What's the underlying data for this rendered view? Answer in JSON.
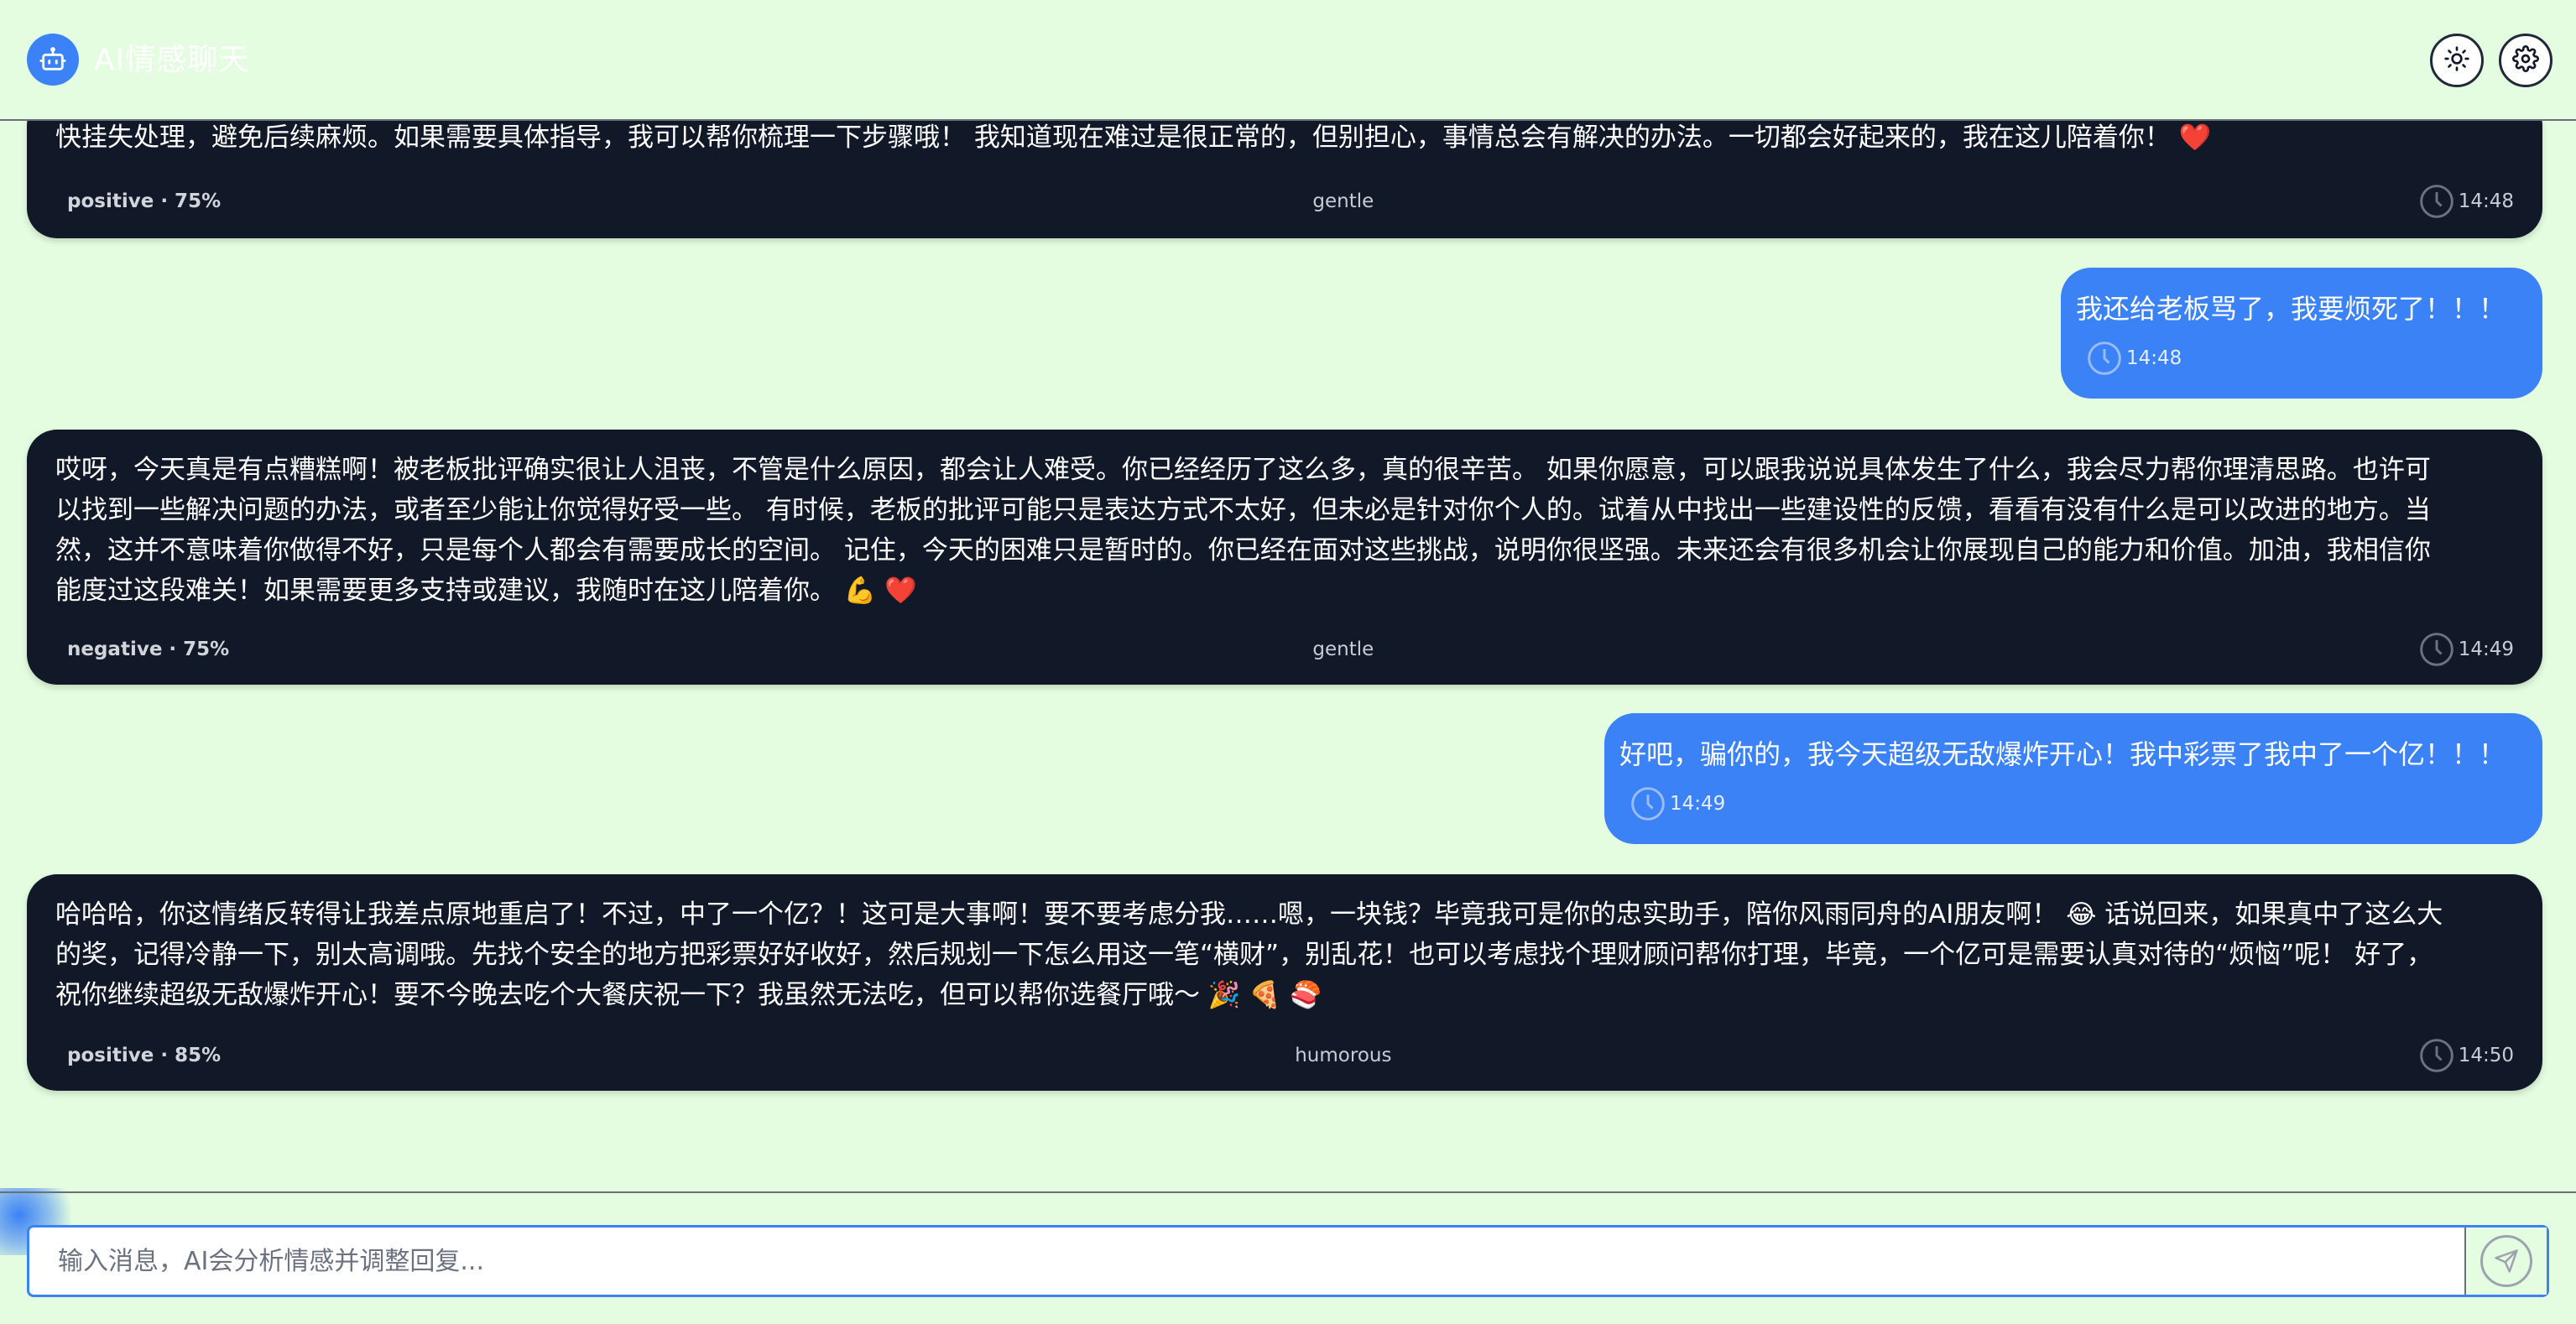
{
  "app": {
    "title": "AI情感聊天"
  },
  "header": {
    "theme_icon": "sun-icon",
    "settings_icon": "gear-icon"
  },
  "messages": [
    {
      "role": "ai",
      "text": "快挂失处理，避免后续麻烦。如果需要具体指导，我可以帮你梳理一下步骤哦！ 我知道现在难过是很正常的，但别担心，事情总会有解决的办法。一切都会好起来的，我在这儿陪着你！ ❤️",
      "sentiment": "positive · 75%",
      "tone": "gentle",
      "time": "14:48"
    },
    {
      "role": "user",
      "text": "我还给老板骂了，我要烦死了！！！",
      "time": "14:48"
    },
    {
      "role": "ai",
      "lines": [
        "哎呀，今天真是有点糟糕啊！被老板批评确实很让人沮丧，不管是什么原因，都会让人难受。你已经经历了这么多，真的很辛苦。 如果你愿意，可以跟我说说具体发生了什么，我会尽力帮你理清思路。也许可",
        "以找到一些解决问题的办法，或者至少能让你觉得好受一些。 有时候，老板的批评可能只是表达方式不太好，但未必是针对你个人的。试着从中找出一些建设性的反馈，看看有没有什么是可以改进的地方。当",
        "然，这并不意味着你做得不好，只是每个人都会有需要成长的空间。 记住，今天的困难只是暂时的。你已经在面对这些挑战，说明你很坚强。未来还会有很多机会让你展现自己的能力和价值。加油，我相信你",
        "能度过这段难关！如果需要更多支持或建议，我随时在这儿陪着你。 💪 ❤️"
      ],
      "sentiment": "negative · 75%",
      "tone": "gentle",
      "time": "14:49"
    },
    {
      "role": "user",
      "text": "好吧，骗你的，我今天超级无敌爆炸开心！我中彩票了我中了一个亿！！！",
      "time": "14:49"
    },
    {
      "role": "ai",
      "lines": [
        "哈哈哈，你这情绪反转得让我差点原地重启了！不过，中了一个亿？！这可是大事啊！要不要考虑分我……嗯，一块钱？毕竟我可是你的忠实助手，陪你风雨同舟的AI朋友啊！ 😂 话说回来，如果真中了这么大",
        "的奖，记得冷静一下，别太高调哦。先找个安全的地方把彩票好好收好，然后规划一下怎么用这一笔“横财”，别乱花！也可以考虑找个理财顾问帮你打理，毕竟，一个亿可是需要认真对待的“烦恼”呢！ 好了，",
        "祝你继续超级无敌爆炸开心！要不今晚去吃个大餐庆祝一下？我虽然无法吃，但可以帮你选餐厅哦～ 🎉 🍕 🍣"
      ],
      "sentiment": "positive · 85%",
      "tone": "humorous",
      "time": "14:50"
    }
  ],
  "input": {
    "placeholder": "输入消息，AI会分析情感并调整回复...",
    "value": ""
  },
  "colors": {
    "background": "#e4fde0",
    "ai_bubble": "#111827",
    "user_bubble": "#3b82f6",
    "accent": "#3b82f6"
  }
}
